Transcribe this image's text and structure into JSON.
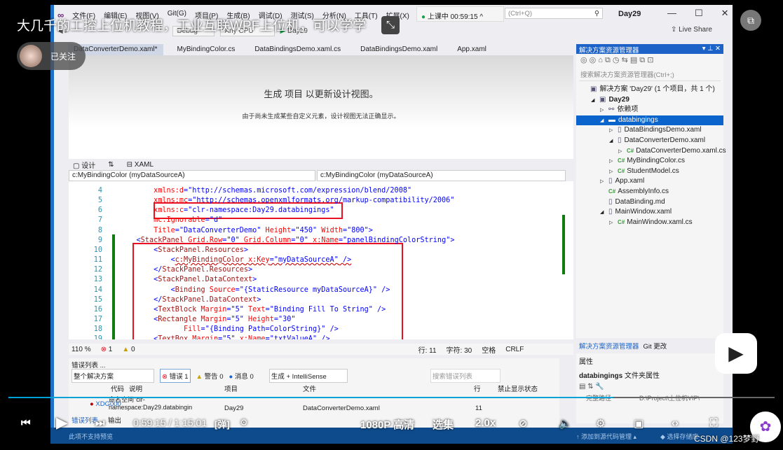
{
  "video": {
    "title": "大几千的工控上位机教程，工业互联WPF上位机，可以学学",
    "follow_label": "已关注",
    "time_current": "0:59:15",
    "time_total": "1:15:01",
    "quality": "1080P 高清",
    "episodes": "选集",
    "speed": "2.0x",
    "danmaku_icon": "弹",
    "progress_percent": 79,
    "watermark": "CSDN @123梦野",
    "colors": {
      "progress": "#00a1d6"
    }
  },
  "vs": {
    "menu": [
      "文件(F)",
      "编辑(E)",
      "视图(V)",
      "Git(G)",
      "项目(P)",
      "生成(B)",
      "调试(D)",
      "测试(S)",
      "分析(N)",
      "工具(T)",
      "扩展(X)"
    ],
    "live_badge": "上课中 00:59:15",
    "search_placeholder": "(Ctrl+Q)",
    "window_title": "Day29",
    "live_share": "Live Share",
    "toolbar": {
      "config": "Debug",
      "platform": "Any CPU",
      "start": "Day29"
    },
    "tabs": [
      "DataConverterDemo.xaml*",
      "MyBindingColor.cs",
      "DataBindingsDemo.xaml.cs",
      "DataBindingsDemo.xaml",
      "App.xaml"
    ],
    "designer": {
      "message": "生成 项目 以更新设计视图。",
      "detail": "由于尚未生成某些自定义元素，设计视图无法正确显示。"
    },
    "split": {
      "design": "设计",
      "swap": "⇅",
      "xaml": "XAML"
    },
    "dropdowns": [
      "c:MyBindingColor (myDataSourceA)",
      "c:MyBindingColor (myDataSourceA)"
    ],
    "code": [
      {
        "n": "4",
        "seg": [
          [
            "a",
            "        xmlns:d"
          ],
          [
            "p",
            "="
          ],
          [
            "v",
            "\"http://schemas.microsoft.com/expression/blend/2008\""
          ]
        ]
      },
      {
        "n": "5",
        "seg": [
          [
            "a",
            "        xmlns:mc"
          ],
          [
            "p",
            "="
          ],
          [
            "v",
            "\"http://schemas.openxmlformats.org/markup-compatibility/2006\""
          ]
        ]
      },
      {
        "n": "6",
        "seg": [
          [
            "a",
            "        xmlns:c"
          ],
          [
            "p",
            "="
          ],
          [
            "v",
            "\"clr-namespace:Day29.databingings\""
          ]
        ]
      },
      {
        "n": "7",
        "seg": [
          [
            "a",
            "        mc:Ignorable"
          ],
          [
            "p",
            "="
          ],
          [
            "v",
            "\"d\""
          ]
        ]
      },
      {
        "n": "8",
        "seg": [
          [
            "a",
            "        Title"
          ],
          [
            "p",
            "="
          ],
          [
            "v",
            "\"DataConverterDemo\""
          ],
          [
            "a",
            " Height"
          ],
          [
            "p",
            "="
          ],
          [
            "v",
            "\"450\""
          ],
          [
            "a",
            " Width"
          ],
          [
            "p",
            "="
          ],
          [
            "v",
            "\"800\""
          ],
          [
            "p",
            ">"
          ]
        ]
      },
      {
        "n": "9",
        "seg": [
          [
            "p",
            "    <"
          ],
          [
            "t",
            "StackPanel"
          ],
          [
            "a",
            " Grid.Row"
          ],
          [
            "p",
            "="
          ],
          [
            "v",
            "\"0\""
          ],
          [
            "a",
            " Grid.Column"
          ],
          [
            "p",
            "="
          ],
          [
            "v",
            "\"0\""
          ],
          [
            "a",
            " x:Name"
          ],
          [
            "p",
            "="
          ],
          [
            "v",
            "\"panelBindingColorString\""
          ],
          [
            "p",
            ">"
          ]
        ]
      },
      {
        "n": "10",
        "seg": [
          [
            "p",
            "        <"
          ],
          [
            "t",
            "StackPanel.Resources"
          ],
          [
            "p",
            ">"
          ]
        ]
      },
      {
        "n": "11",
        "seg": [
          [
            "p",
            "            <"
          ],
          [
            "t",
            "c:MyBindingColor"
          ],
          [
            "a",
            " x:Key"
          ],
          [
            "p",
            "="
          ],
          [
            "v",
            "\"myDataSourceA\""
          ],
          [
            "p",
            " />"
          ]
        ]
      },
      {
        "n": "12",
        "seg": [
          [
            "p",
            "        </"
          ],
          [
            "t",
            "StackPanel.Resources"
          ],
          [
            "p",
            ">"
          ]
        ]
      },
      {
        "n": "13",
        "seg": [
          [
            "p",
            "        <"
          ],
          [
            "t",
            "StackPanel.DataContext"
          ],
          [
            "p",
            ">"
          ]
        ]
      },
      {
        "n": "14",
        "seg": [
          [
            "p",
            "            <"
          ],
          [
            "t",
            "Binding"
          ],
          [
            "a",
            " Source"
          ],
          [
            "p",
            "="
          ],
          [
            "v",
            "\"{StaticResource myDataSourceA}\""
          ],
          [
            "p",
            " />"
          ]
        ]
      },
      {
        "n": "15",
        "seg": [
          [
            "p",
            "        </"
          ],
          [
            "t",
            "StackPanel.DataContext"
          ],
          [
            "p",
            ">"
          ]
        ]
      },
      {
        "n": "16",
        "seg": [
          [
            "p",
            "        <"
          ],
          [
            "t",
            "TextBlock"
          ],
          [
            "a",
            " Margin"
          ],
          [
            "p",
            "="
          ],
          [
            "v",
            "\"5\""
          ],
          [
            "a",
            " Text"
          ],
          [
            "p",
            "="
          ],
          [
            "v",
            "\"Binding Fill To String\""
          ],
          [
            "p",
            " />"
          ]
        ]
      },
      {
        "n": "17",
        "seg": [
          [
            "p",
            "        <"
          ],
          [
            "t",
            "Rectangle"
          ],
          [
            "a",
            " Margin"
          ],
          [
            "p",
            "="
          ],
          [
            "v",
            "\"5\""
          ],
          [
            "a",
            " Height"
          ],
          [
            "p",
            "="
          ],
          [
            "v",
            "\"30\""
          ]
        ]
      },
      {
        "n": "18",
        "seg": [
          [
            "a",
            "               Fill"
          ],
          [
            "p",
            "="
          ],
          [
            "v",
            "\"{Binding Path=ColorString}\""
          ],
          [
            "p",
            " />"
          ]
        ]
      },
      {
        "n": "19",
        "seg": [
          [
            "p",
            "        <"
          ],
          [
            "t",
            "TextBox"
          ],
          [
            "a",
            " Margin"
          ],
          [
            "p",
            "="
          ],
          [
            "v",
            "\"5\""
          ],
          [
            "a",
            " x:Name"
          ],
          [
            "p",
            "="
          ],
          [
            "v",
            "\"txtValueA\""
          ],
          [
            "p",
            " />"
          ]
        ]
      }
    ],
    "status": {
      "zoom": "110 %",
      "errors": "1",
      "warnings": "0",
      "line": "行: 11",
      "col": "字符: 30",
      "spaces": "空格",
      "eol": "CRLF"
    },
    "errorlist": {
      "title": "错误列表 ...",
      "scope": "整个解决方案",
      "errors": "错误 1",
      "warnings": "警告 0",
      "messages": "消息 0",
      "source": "生成 + IntelliSense",
      "search": "搜索错误列表",
      "columns": [
        "代码",
        "说明",
        "项目",
        "文件",
        "行",
        "禁止显示状态"
      ],
      "row": {
        "code": "XDG000",
        "desc": "命名空间\"clr-namespace:Day29.databingin",
        "project": "Day29",
        "file": "DataConverterDemo.xaml",
        "line": "11"
      },
      "tabs": [
        "错误列表",
        "输出"
      ]
    },
    "bottom_status": {
      "left": "此项不支持预览",
      "add_source": "添加到源代码管理",
      "repo": "选择存储库"
    },
    "solution": {
      "title": "解决方案资源管理器",
      "search": "搜索解决方案资源管理器(Ctrl+;)",
      "items": [
        {
          "label": "解决方案 'Day29' (1 个项目，共 1 个)",
          "indent": 0,
          "arrow": "",
          "icon": "sln"
        },
        {
          "label": "Day29",
          "indent": 1,
          "arrow": "◢",
          "icon": "proj",
          "bold": true
        },
        {
          "label": "依赖项",
          "indent": 2,
          "arrow": "▷",
          "icon": "dep"
        },
        {
          "label": "databingings",
          "indent": 2,
          "arrow": "◢",
          "icon": "folder",
          "selected": true
        },
        {
          "label": "DataBindingsDemo.xaml",
          "indent": 3,
          "arrow": "▷",
          "icon": "xaml"
        },
        {
          "label": "DataConverterDemo.xaml",
          "indent": 3,
          "arrow": "◢",
          "icon": "xaml"
        },
        {
          "label": "DataConverterDemo.xaml.cs",
          "indent": 4,
          "arrow": "▷",
          "icon": "cs"
        },
        {
          "label": "MyBindingColor.cs",
          "indent": 3,
          "arrow": "▷",
          "icon": "cs"
        },
        {
          "label": "StudentModel.cs",
          "indent": 3,
          "arrow": "▷",
          "icon": "cs"
        },
        {
          "label": "App.xaml",
          "indent": 2,
          "arrow": "▷",
          "icon": "xaml"
        },
        {
          "label": "AssemblyInfo.cs",
          "indent": 2,
          "arrow": "",
          "icon": "cs"
        },
        {
          "label": "DataBinding.md",
          "indent": 2,
          "arrow": "",
          "icon": "md"
        },
        {
          "label": "MainWindow.xaml",
          "indent": 2,
          "arrow": "◢",
          "icon": "xaml"
        },
        {
          "label": "MainWindow.xaml.cs",
          "indent": 3,
          "arrow": "▷",
          "icon": "cs"
        }
      ],
      "tabs": [
        "解决方案资源管理器",
        "Git 更改"
      ]
    },
    "properties": {
      "title": "属性",
      "object": "databingings",
      "kind": "文件夹属性",
      "row_label": "完整路径",
      "row_value": "D:\\Project\\上位机VIP\\"
    }
  }
}
